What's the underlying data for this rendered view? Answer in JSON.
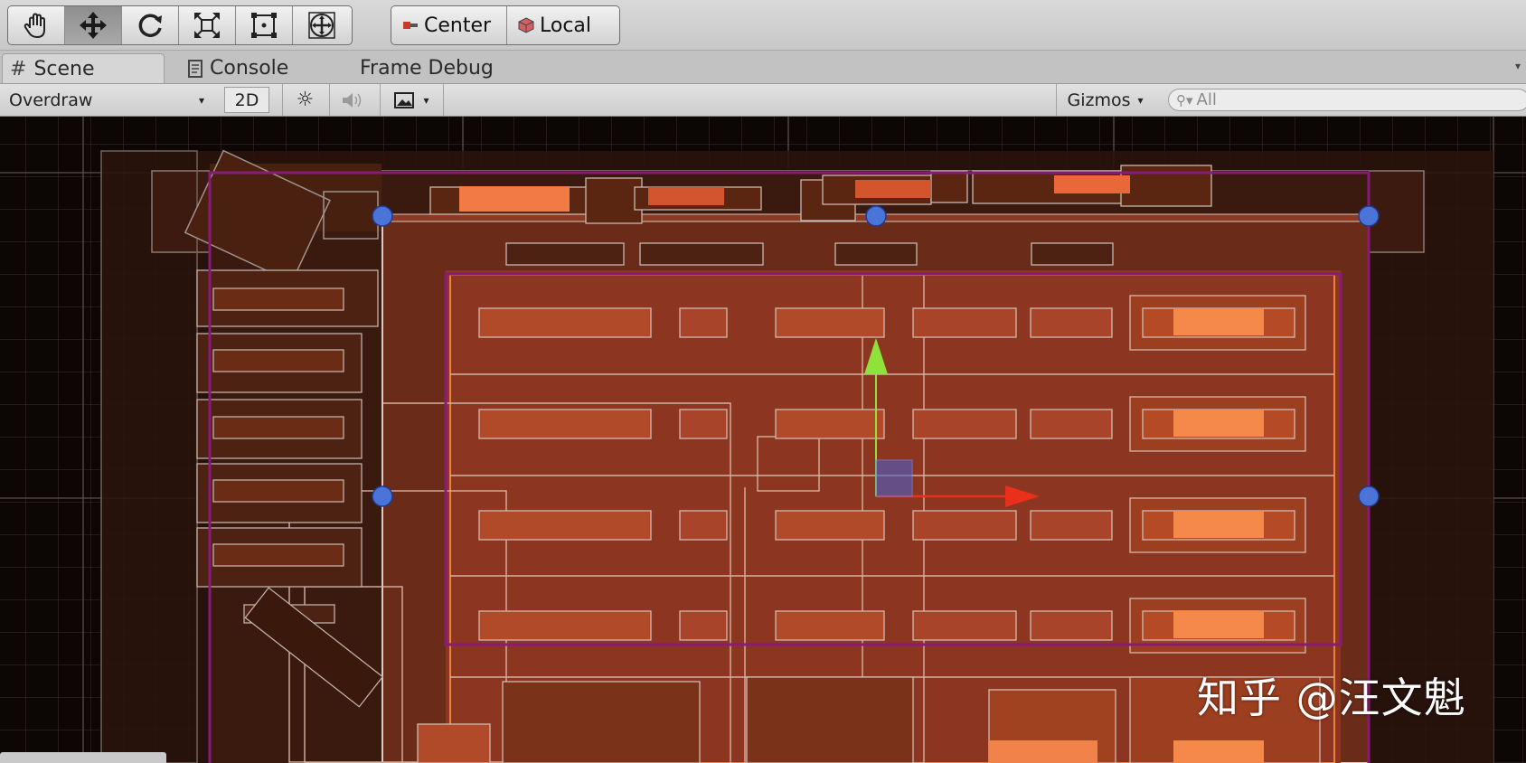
{
  "toolbar": {
    "tools": [
      {
        "name": "hand-tool",
        "icon": "hand-icon",
        "active": false
      },
      {
        "name": "move-tool",
        "icon": "move-arrows-icon",
        "active": true
      },
      {
        "name": "rotate-tool",
        "icon": "rotate-icon",
        "active": false
      },
      {
        "name": "scale-tool",
        "icon": "scale-icon",
        "active": false
      },
      {
        "name": "rect-tool",
        "icon": "rect-transform-icon",
        "active": false
      },
      {
        "name": "transform-tool",
        "icon": "transform-icon",
        "active": false
      }
    ],
    "pivot_mode_label": "Center",
    "pivot_rotation_label": "Local"
  },
  "tabs": [
    {
      "label": "Scene",
      "icon": "grid-icon",
      "active": true
    },
    {
      "label": "Console",
      "icon": "console-icon",
      "active": false
    },
    {
      "label": "Frame Debug",
      "icon": "",
      "active": false
    }
  ],
  "scene_toolbar": {
    "draw_mode": "Overdraw",
    "mode_2d_label": "2D",
    "gizmos_label": "Gizmos",
    "search_placeholder": "All"
  },
  "watermark": "知乎 @汪文魁",
  "colors": {
    "selection_outline": "#8a1a7a",
    "handle": "#4a74d8",
    "axis_y": "#8ee23a",
    "axis_x": "#e8301c",
    "overdraw_base": "#8c3520"
  }
}
